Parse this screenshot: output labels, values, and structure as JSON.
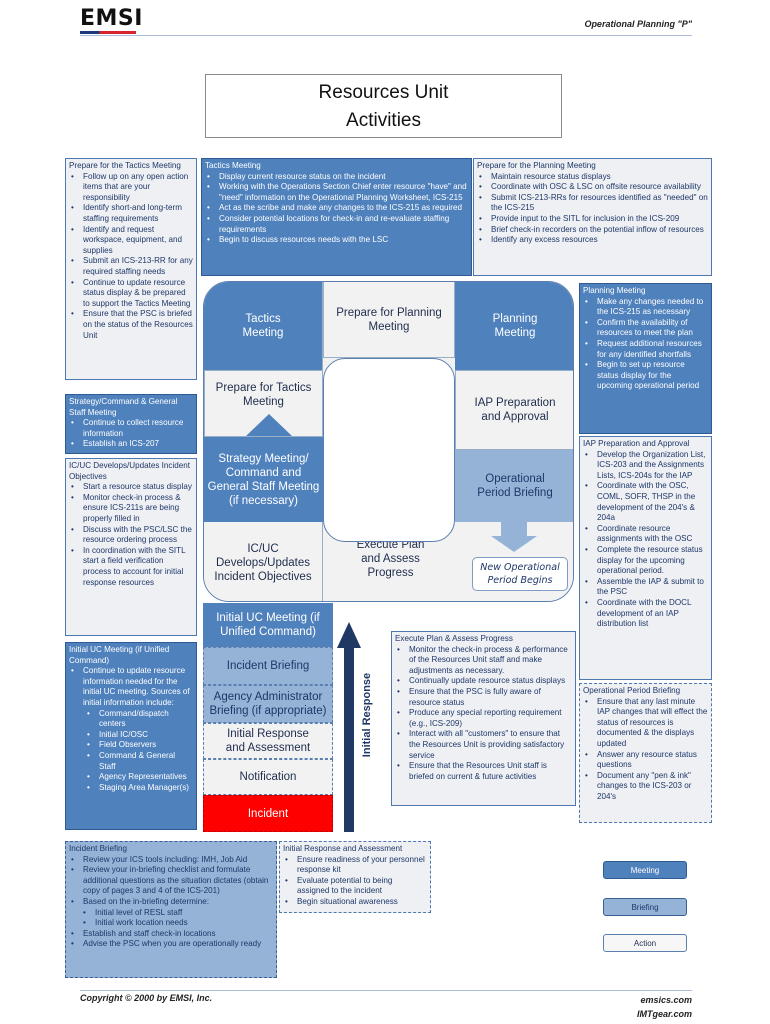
{
  "header": {
    "logo": "EMSI",
    "subtitle": "Operational Planning \"P\""
  },
  "title": {
    "line1": "Resources Unit",
    "line2": "Activities"
  },
  "colors": {
    "meeting": "#4f81bd",
    "briefing": "#95b3d7",
    "action": "#f2f2f2",
    "incident": "#ff0000",
    "initial_response_arrow": "#1f3864"
  },
  "diagram": {
    "tactics_meeting": "Tactics Meeting",
    "prepare_planning": "Prepare for Planning Meeting",
    "planning_meeting": "Planning Meeting",
    "prepare_tactics": "Prepare for Tactics Meeting",
    "iap_prep": "IAP Preparation and Approval",
    "strategy_meeting": "Strategy Meeting/ Command and General Staff Meeting (if necessary)",
    "op_period_briefing": "Operational Period Briefing",
    "icuc_objectives": "IC/UC Develops/Updates Incident Objectives",
    "execute_plan": "Execute Plan and Assess Progress",
    "new_period": "New Operational Period Begins",
    "initial_uc_meeting": "Initial UC Meeting (if Unified Command)",
    "incident_briefing": "Incident Briefing",
    "agency_admin_briefing": "Agency Administrator Briefing (if appropriate)",
    "initial_response": "Initial Response and Assessment",
    "notification": "Notification",
    "incident": "Incident",
    "initial_response_label": "Initial Response"
  },
  "notes": {
    "prepare_tactics": {
      "title": "Prepare for the Tactics Meeting",
      "items": [
        "Follow up on any open action items that are your responsibility",
        "Identify short-and long-term staffing requirements",
        "Identify and request workspace, equipment, and supplies",
        "Submit an ICS-213-RR for any required staffing needs",
        "Continue to update resource status display & be prepared to support the Tactics Meeting",
        "Ensure that the PSC is briefed on the status of the Resources Unit"
      ]
    },
    "tactics_meeting": {
      "title": "Tactics Meeting",
      "items": [
        "Display current resource status on the incident",
        "Working with the Operations Section Chief enter resource \"have\" and \"need\" information on the Operational Planning Worksheet, ICS-215",
        "Act as the scribe and make any changes to the ICS-215 as required",
        "Consider potential locations for check-in and re-evaluate staffing requirements",
        "Begin to discuss resources needs with the LSC"
      ]
    },
    "prepare_planning": {
      "title": "Prepare for the Planning Meeting",
      "items": [
        "Maintain resource status displays",
        "Coordinate with OSC & LSC on offsite resource availability",
        "Submit ICS-213-RRs for resources identified as \"needed\" on the ICS-215",
        "Provide input to the SITL for inclusion in the ICS-209",
        "Brief check-in recorders on the potential inflow of resources",
        "Identify any excess resources"
      ]
    },
    "planning_meeting": {
      "title": "Planning Meeting",
      "items": [
        "Make any changes needed to the ICS-215 as necessary",
        "Confirm the availability of resources to meet the plan",
        "Request additional resources for any identified shortfalls",
        "Begin to set up resource status display for the upcoming operational period"
      ]
    },
    "iap_prep": {
      "title": "IAP Preparation and Approval",
      "items": [
        "Develop the Organization List, ICS-203 and the Assignments Lists, ICS-204s for the IAP",
        "Coordinate with the OSC, COML, SOFR, THSP in the development of the 204's & 204a",
        "Coordinate resource assignments with the OSC",
        "Complete the resource status display for the upcoming operational period.",
        "Assemble the IAP & submit to the PSC",
        "Coordinate with the DOCL development of an IAP distribution list"
      ]
    },
    "op_period_briefing": {
      "title": "Operational Period Briefing",
      "items": [
        "Ensure that any last minute IAP changes that will effect the status of resources is documented & the displays updated",
        "Answer any resource status questions",
        "Document any \"pen & ink\" changes to the ICS-203 or 204's"
      ]
    },
    "strategy_meeting": {
      "title": "Strategy/Command & General Staff Meeting",
      "items": [
        "Continue to collect resource information",
        "Establish an ICS-207"
      ]
    },
    "icuc_objectives": {
      "title": "IC/UC Develops/Updates Incident Objectives",
      "items": [
        "Start a resource status display",
        "Monitor check-in process & ensure ICS-211s are being properly filled in",
        "Discuss with the PSC/LSC the resource ordering process",
        "In coordination with the SITL start a field verification process to account for initial response resources"
      ]
    },
    "initial_uc_meeting": {
      "title": "Initial UC Meeting (if Unified Command)",
      "items": [
        "Continue to update resource information needed for the initial UC meeting. Sources of initial information include:"
      ],
      "subitems": [
        "Command/dispatch centers",
        "Initial IC/OSC",
        "Field Observers",
        "Command & General Staff",
        "Agency Representatives",
        "Staging Area Manager(s)"
      ]
    },
    "execute_plan": {
      "title": "Execute Plan & Assess Progress",
      "items": [
        "Monitor the check-in process & performance of the Resources Unit staff and make adjustments as necessary.",
        "Continually update resource status displays",
        "Ensure that the PSC is fully aware of resource status",
        "Produce any special reporting requirement (e.g., ICS-209)",
        "Interact with all \"customers\" to ensure that the Resources Unit is providing satisfactory service",
        "Ensure that the Resources Unit staff is briefed on current & future activities"
      ]
    },
    "incident_briefing": {
      "title": "Incident Briefing",
      "items_a": [
        "Review your ICS tools including: IMH, Job Aid",
        "Review your in-briefing checklist and formulate additional questions as the situation dictates (obtain copy of pages 3 and 4 of the ICS-201)",
        "Based on the in-briefing determine:"
      ],
      "subitems": [
        "Initial level of RESL staff",
        "Initial work location needs"
      ],
      "items_b": [
        "Establish and staff check-in locations",
        "Advise the PSC when you are operationally ready"
      ]
    },
    "initial_response": {
      "title": "Initial Response and Assessment",
      "items": [
        "Ensure readiness of your personnel response kit",
        "Evaluate potential to being assigned to the incident",
        "Begin situational awareness"
      ]
    }
  },
  "legend": {
    "meeting": "Meeting",
    "briefing": "Briefing",
    "action": "Action"
  },
  "footer": {
    "copyright": "Copyright © 2000 by EMSI, Inc.",
    "site1": "emsics.com",
    "site2": "IMTgear.com"
  }
}
